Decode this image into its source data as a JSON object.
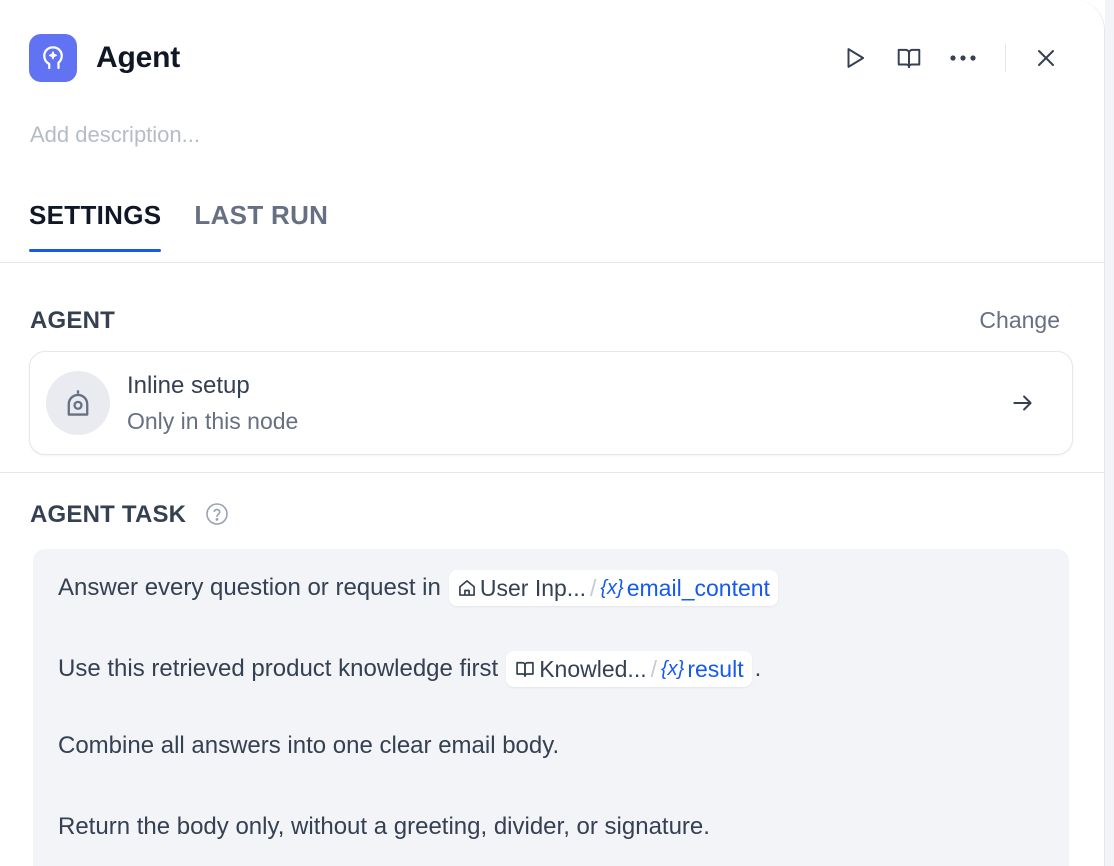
{
  "header": {
    "title": "Agent",
    "actions": [
      "play-icon",
      "book-icon",
      "more-icon",
      "close-icon"
    ]
  },
  "description": {
    "placeholder": "Add description..."
  },
  "tabs": [
    {
      "label": "SETTINGS",
      "active": true
    },
    {
      "label": "LAST RUN",
      "active": false
    }
  ],
  "agent_section": {
    "label": "AGENT",
    "change_label": "Change",
    "card": {
      "name": "Inline setup",
      "subtitle": "Only in this node"
    }
  },
  "task_section": {
    "label": "AGENT TASK",
    "lines": [
      {
        "text": "Answer every question or request in",
        "chip": {
          "source": "User Inp...",
          "source_icon": "home-icon",
          "variable": "email_content",
          "var_icon": "variable-icon"
        },
        "suffix": ""
      },
      {
        "text": "Use this retrieved product knowledge first",
        "chip": {
          "source": "Knowled...",
          "source_icon": "book-icon",
          "variable": "result",
          "var_icon": "variable-icon"
        },
        "suffix": "."
      },
      {
        "text": "Combine all answers into one clear email body."
      },
      {
        "text": "Return the body only, without a greeting, divider, or signature."
      }
    ]
  },
  "colors": {
    "accent": "#155aef",
    "app_icon_bg": "#6172f3",
    "task_bg": "#f2f4f7"
  }
}
